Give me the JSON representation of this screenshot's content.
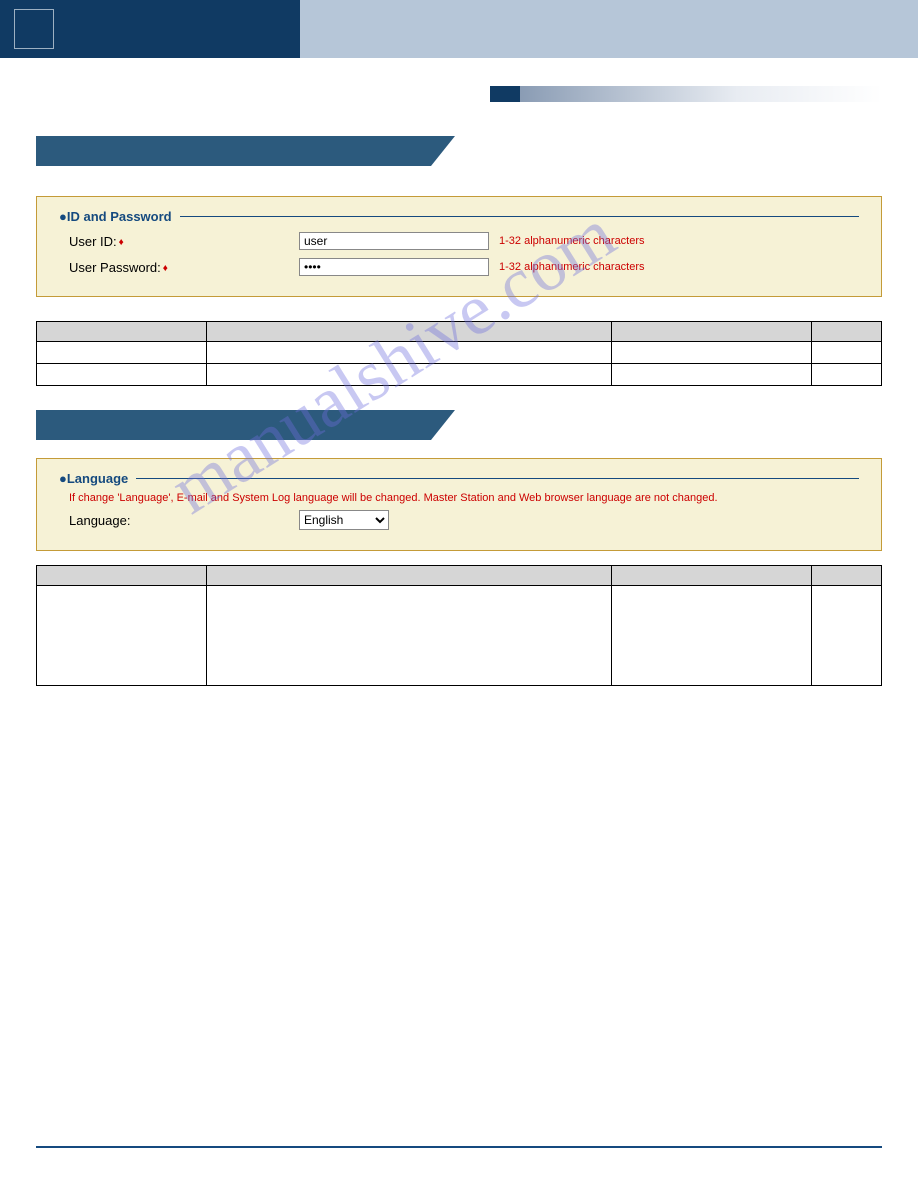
{
  "watermark": "manualshive.com",
  "sections": {
    "idpw": {
      "legend": "ID and Password",
      "rows": {
        "user_id": {
          "label": "User ID:",
          "value": "user",
          "hint": "1-32 alphanumeric characters"
        },
        "user_password": {
          "label": "User Password:",
          "value": "••••",
          "hint": "1-32 alphanumeric characters"
        }
      }
    },
    "language": {
      "legend": "Language",
      "warning": "If change 'Language', E-mail and System Log language will be changed. Master Station and Web browser language are not changed.",
      "label": "Language:",
      "selected": "English"
    }
  },
  "tables": {
    "headers": {
      "entry": "",
      "description": "",
      "setting": "",
      "default": ""
    }
  }
}
